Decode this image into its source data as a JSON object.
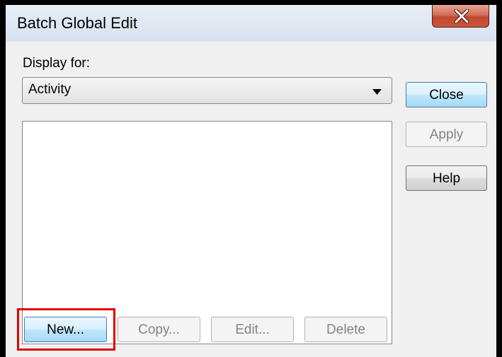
{
  "window": {
    "title": "Batch Global Edit",
    "close_icon": "close-x-icon"
  },
  "display_for": {
    "label": "Display for:",
    "selected": "Activity"
  },
  "side_buttons": {
    "close": "Close",
    "apply": "Apply",
    "help": "Help"
  },
  "bottom_buttons": {
    "new": "New...",
    "copy": "Copy...",
    "edit": "Edit...",
    "delete": "Delete"
  },
  "colors": {
    "highlight": "#e00000",
    "close_button": "#c24a30",
    "default_button_border": "#3c7fb1"
  }
}
